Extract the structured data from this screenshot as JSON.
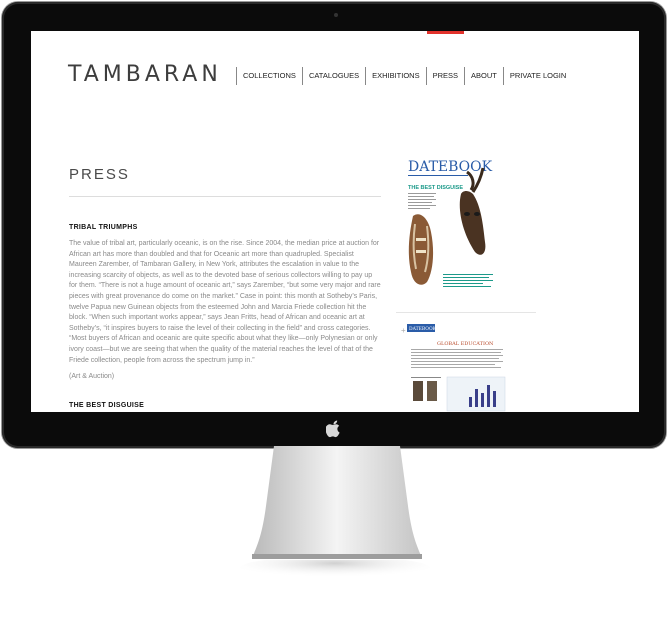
{
  "site": {
    "logo": "TAMBARAN",
    "nav": [
      {
        "label": "COLLECTIONS",
        "active": false
      },
      {
        "label": "CATALOGUES",
        "active": false
      },
      {
        "label": "EXHIBITIONS",
        "active": false
      },
      {
        "label": "PRESS",
        "active": true
      },
      {
        "label": "ABOUT",
        "active": false
      },
      {
        "label": "PRIVATE LOGIN",
        "active": false
      }
    ],
    "accent_color": "#e2322c"
  },
  "page": {
    "title": "PRESS",
    "articles": [
      {
        "heading": "TRIBAL TRIUMPHS",
        "body": "The value of tribal art, particularly oceanic, is on the rise. Since 2004, the median price at auction for African art has more than doubled and that for Oceanic art more than quadrupled. Specialist Maureen Zarember, of Tambaran Gallery, in New York, attributes the escalation in value to the increasing scarcity of objects, as well as to the devoted base of serious collectors willing to pay up for them. “There is not a huge amount of oceanic art,” says Zarember, “but some very major and rare pieces with great provenance do come on the market.” Case in point: this month at Sotheby’s Paris, twelve Papua new Guinean objects from the esteemed John and Marcia Friede collection hit the block. “When such important works appear,” says Jean Fritts, head of African and oceanic art at Sotheby’s, “it inspires buyers to raise the level of their collecting in the field” and cross categories. “Most buyers of African and oceanic are quite specific about what they like—only Polynesian or only ivory coast—but we are seeing that when the quality of the material reaches the level of that of the Friede collection, people from across the spectrum jump in.”",
        "source": "(Art & Auction)"
      },
      {
        "heading": "THE BEST DISGUISE"
      }
    ]
  },
  "press_images": {
    "datebook": {
      "masthead": "DATEBOOK",
      "headline": "THE BEST DISGUISE"
    },
    "clipping": {
      "badge": "DATEBOOK",
      "headline": "GLOBAL EDUCATION"
    }
  }
}
